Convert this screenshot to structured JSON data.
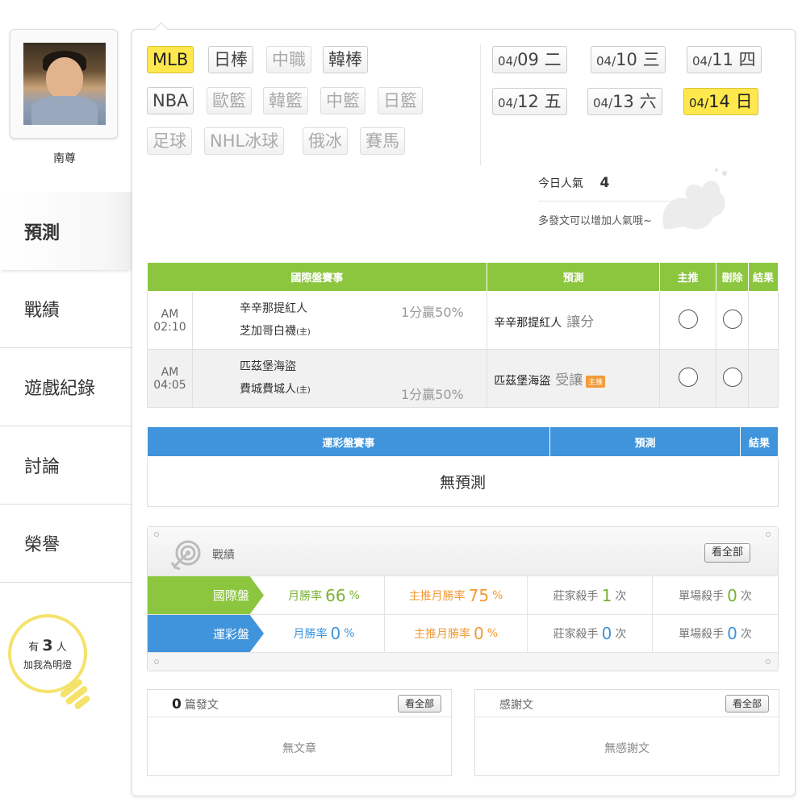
{
  "user": {
    "name": "南尊"
  },
  "menu": [
    {
      "label": "預測",
      "active": true
    },
    {
      "label": "戰績"
    },
    {
      "label": "遊戲紀錄"
    },
    {
      "label": "討論"
    },
    {
      "label": "榮譽"
    }
  ],
  "fans": {
    "prefix": "有",
    "count": "3",
    "suffix": "人",
    "cta": "加我為明燈"
  },
  "sports": [
    {
      "label": "MLB",
      "state": "active"
    },
    {
      "label": "日棒",
      "state": "normal"
    },
    {
      "label": "中職",
      "state": "muted"
    },
    {
      "label": "韓棒",
      "state": "normal"
    },
    {
      "label": "NBA",
      "state": "normal"
    },
    {
      "label": "歐籃",
      "state": "muted"
    },
    {
      "label": "韓籃",
      "state": "muted"
    },
    {
      "label": "中籃",
      "state": "muted"
    },
    {
      "label": "日籃",
      "state": "muted"
    },
    {
      "label": "足球",
      "state": "muted"
    },
    {
      "label": "NHL冰球",
      "state": "muted"
    },
    {
      "label": "俄冰",
      "state": "muted"
    },
    {
      "label": "賽馬",
      "state": "muted"
    }
  ],
  "dates": [
    {
      "month": "04/",
      "day": "09",
      "weekday": "二",
      "active": false
    },
    {
      "month": "04/",
      "day": "10",
      "weekday": "三",
      "active": false
    },
    {
      "month": "04/",
      "day": "11",
      "weekday": "四",
      "active": false
    },
    {
      "month": "04/",
      "day": "12",
      "weekday": "五",
      "active": false
    },
    {
      "month": "04/",
      "day": "13",
      "weekday": "六",
      "active": false
    },
    {
      "month": "04/",
      "day": "14",
      "weekday": "日",
      "active": true
    }
  ],
  "popularity": {
    "label": "今日人氣",
    "value": "4",
    "tip": "多發文可以增加人氣哦~"
  },
  "intl_table": {
    "headers": [
      "國際盤賽事",
      "預測",
      "主推",
      "刪除",
      "結果"
    ],
    "rows": [
      {
        "time": "AM 02:10",
        "team_a": "辛辛那提紅人",
        "team_b": "芝加哥白襪",
        "home": "(主)",
        "odds": "1分贏50%",
        "odds_row": "a",
        "pick": "辛辛那提紅人",
        "pick_type": "讓分",
        "featured": ""
      },
      {
        "time": "AM 04:05",
        "team_a": "匹茲堡海盜",
        "team_b": "費城費城人",
        "home": "(主)",
        "odds": "1分贏50%",
        "odds_row": "b",
        "pick": "匹茲堡海盜",
        "pick_type": "受讓",
        "featured": "主推"
      }
    ]
  },
  "lottery_table": {
    "headers": [
      "運彩盤賽事",
      "預測",
      "結果"
    ],
    "empty": "無預測"
  },
  "record": {
    "title": "戰績",
    "view_all": "看全部",
    "rows": [
      {
        "label": "國際盤",
        "color": "#8cc63f",
        "month_label": "月勝率",
        "month_value": "66",
        "month_unit": "%",
        "main_label": "主推月勝率",
        "main_value": "75",
        "main_unit": "%",
        "dealer_label": "莊家殺手",
        "dealer_value": "1",
        "dealer_unit": "次",
        "single_label": "單場殺手",
        "single_value": "0",
        "single_unit": "次"
      },
      {
        "label": "運彩盤",
        "color": "#3f94db",
        "month_label": "月勝率",
        "month_value": "0",
        "month_unit": "%",
        "main_label": "主推月勝率",
        "main_value": "0",
        "main_unit": "%",
        "dealer_label": "莊家殺手",
        "dealer_value": "0",
        "dealer_unit": "次",
        "single_label": "單場殺手",
        "single_value": "0",
        "single_unit": "次"
      }
    ]
  },
  "posts": {
    "count": "0",
    "label": "篇發文",
    "view_all": "看全部",
    "empty": "無文章"
  },
  "thanks": {
    "label": "感謝文",
    "view_all": "看全部",
    "empty": "無感謝文"
  }
}
